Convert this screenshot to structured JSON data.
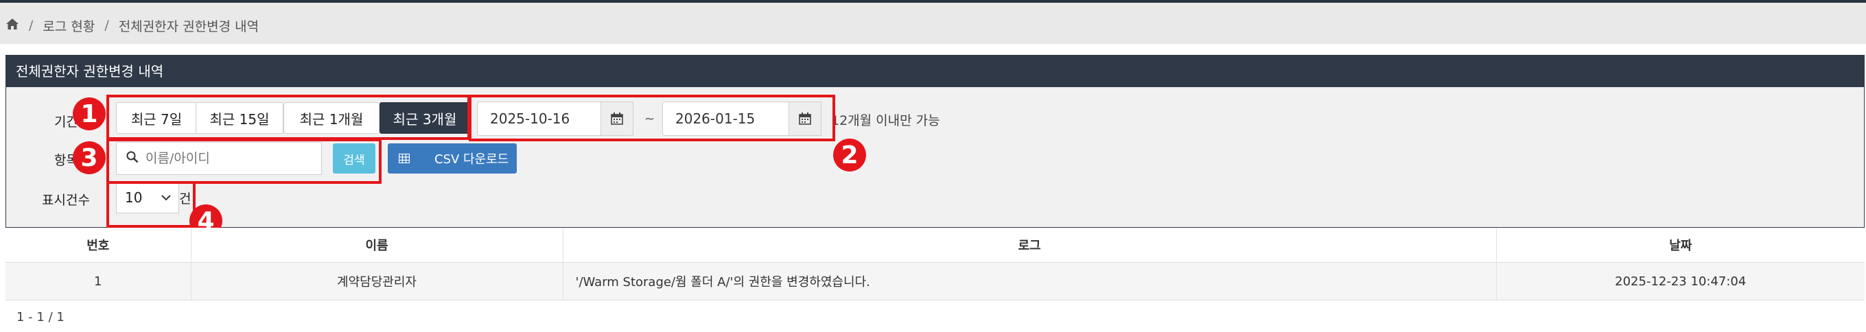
{
  "breadcrumb": {
    "home_icon": "home-icon",
    "items": [
      "로그 현황",
      "전체권한자 권한변경 내역"
    ],
    "separator": "/"
  },
  "panel": {
    "title": "전체권한자 권한변경 내역"
  },
  "filters": {
    "period_label": "기간",
    "period_buttons": [
      "최근 7일",
      "최근 15일",
      "최근 1개월",
      "최근 3개월"
    ],
    "active_period_index": 3,
    "start_date": "2025-10-16",
    "end_date": "2026-01-15",
    "range_separator": "~",
    "date_note": "12개월 이내만 가능",
    "item_label": "항목",
    "search_placeholder": "이름/아이디",
    "search_button": "검색",
    "csv_button": "CSV 다운로드",
    "count_label": "표시건수",
    "count_value": "10",
    "count_unit": "건"
  },
  "markers": [
    "1",
    "2",
    "3",
    "4"
  ],
  "table": {
    "columns": [
      "번호",
      "이름",
      "로그",
      "날짜"
    ],
    "rows": [
      {
        "no": "1",
        "name": "계약담당관리자",
        "log": "'/Warm Storage/웜 폴더 A/'의 권한을 변경하였습니다.",
        "date": "2025-12-23 10:47:04"
      }
    ]
  },
  "pagination": "1 - 1 / 1",
  "colors": {
    "header_dark": "#2f3947",
    "accent_red": "#e4161b",
    "search_blue": "#5bc0de",
    "csv_blue": "#3a7bbf"
  }
}
